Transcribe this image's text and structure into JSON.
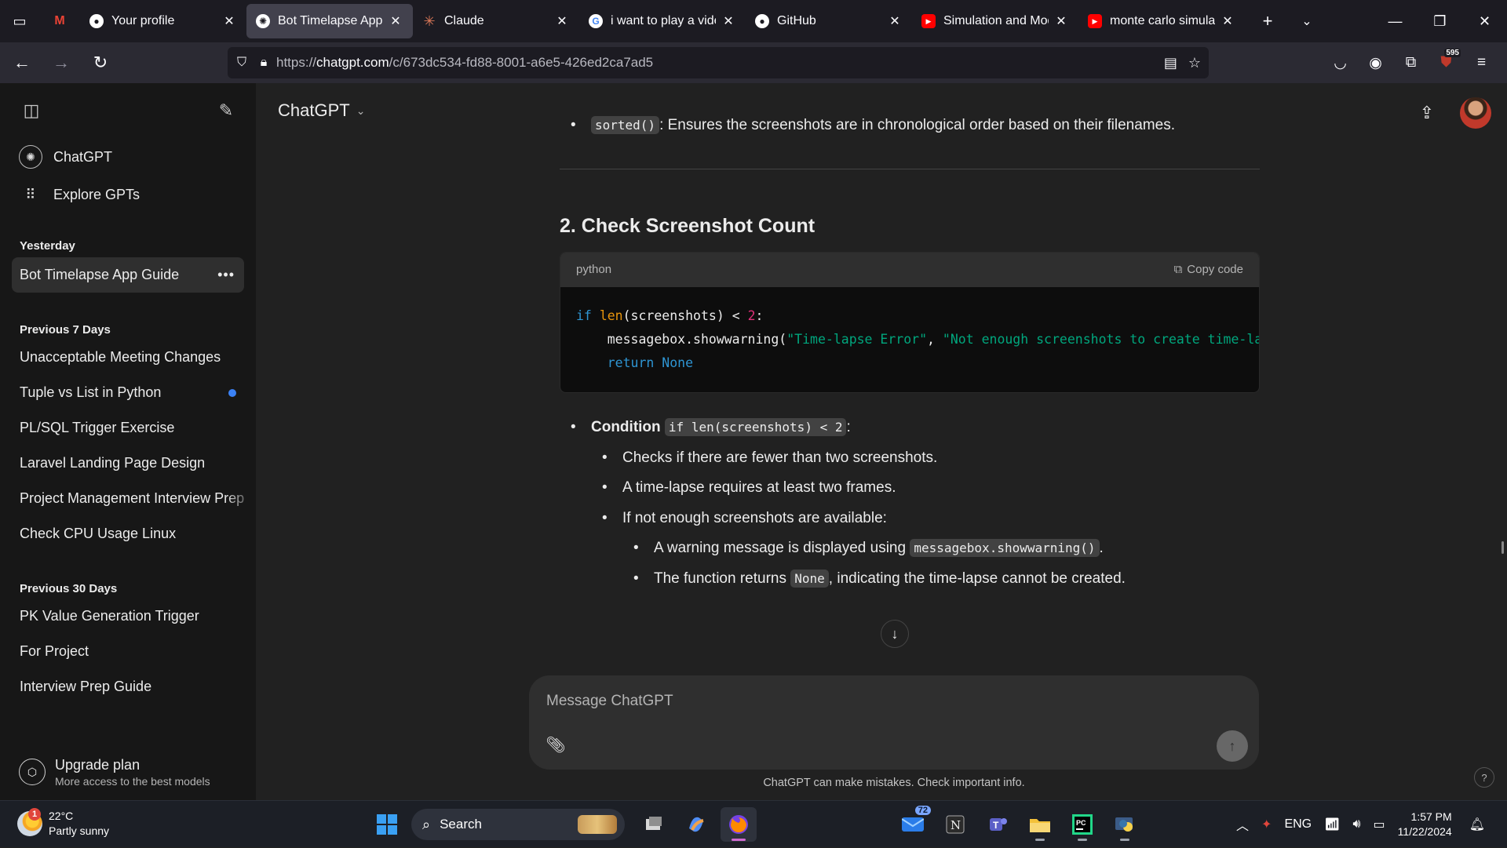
{
  "browser": {
    "tabs": [
      {
        "title": "",
        "favicon": "gmail",
        "pinned": true
      },
      {
        "title": "Your profile",
        "favicon": "github"
      },
      {
        "title": "Bot Timelapse App (",
        "favicon": "chatgpt",
        "active": true
      },
      {
        "title": "Claude",
        "favicon": "claude"
      },
      {
        "title": "i want to play a vide",
        "favicon": "google"
      },
      {
        "title": "GitHub",
        "favicon": "github"
      },
      {
        "title": "Simulation and Mod",
        "favicon": "youtube"
      },
      {
        "title": "monte carlo simulati",
        "favicon": "youtube"
      }
    ],
    "url_prefix": "https://",
    "url_domain": "chatgpt.com",
    "url_path": "/c/673dc534-fd88-8001-a6e5-426ed2ca7ad5",
    "notification_badge": "595"
  },
  "sidebar": {
    "top_links": [
      {
        "label": "ChatGPT"
      },
      {
        "label": "Explore GPTs"
      }
    ],
    "sections": [
      {
        "title": "Yesterday",
        "items": [
          "Bot Timelapse App Guide"
        ]
      },
      {
        "title": "Previous 7 Days",
        "items": [
          "Unacceptable Meeting Changes",
          "Tuple vs List in Python",
          "PL/SQL Trigger Exercise",
          "Laravel Landing Page Design",
          "Project Management Interview Prep",
          "Check CPU Usage Linux"
        ]
      },
      {
        "title": "Previous 30 Days",
        "items": [
          "PK Value Generation Trigger",
          "For Project",
          "Interview Prep Guide"
        ]
      }
    ],
    "upgrade_title": "Upgrade plan",
    "upgrade_subtitle": "More access to the best models"
  },
  "main": {
    "model_label": "ChatGPT",
    "sorted_code": "sorted()",
    "sorted_desc": ": Ensures the screenshots are in chronological order based on their filenames.",
    "section_heading": "2. Check Screenshot Count",
    "code_lang": "python",
    "copy_label": "Copy code",
    "code_line1_kw": "if",
    "code_line1_fn": "len",
    "code_line1_rest": "(screenshots) < ",
    "code_line1_num": "2",
    "code_line1_end": ":",
    "code_line2_pre": "    messagebox.showwarning(",
    "code_line2_str1": "\"Time-lapse Error\"",
    "code_line2_sep": ", ",
    "code_line2_str2": "\"Not enough screenshots to create time-lapse\"",
    "code_line3_kw": "    return",
    "code_line3_none": "None",
    "condition_label": "Condition",
    "condition_code": "if len(screenshots) < 2",
    "condition_colon": ":",
    "sub_bullets": [
      "Checks if there are fewer than two screenshots.",
      "A time-lapse requires at least two frames.",
      "If not enough screenshots are available:"
    ],
    "warn_pre": "A warning message is displayed using ",
    "warn_code": "messagebox.showwarning()",
    "warn_post": ".",
    "ret_pre": "The function returns ",
    "ret_code": "None",
    "ret_post": ", indicating the time-lapse cannot be created."
  },
  "composer": {
    "placeholder": "Message ChatGPT",
    "disclaimer": "ChatGPT can make mistakes. Check important info."
  },
  "taskbar": {
    "temperature": "22°C",
    "weather": "Partly sunny",
    "weather_badge": "1",
    "search_label": "Search",
    "mail_badge": "72",
    "language": "ENG",
    "time": "1:57 PM",
    "date": "11/22/2024"
  }
}
